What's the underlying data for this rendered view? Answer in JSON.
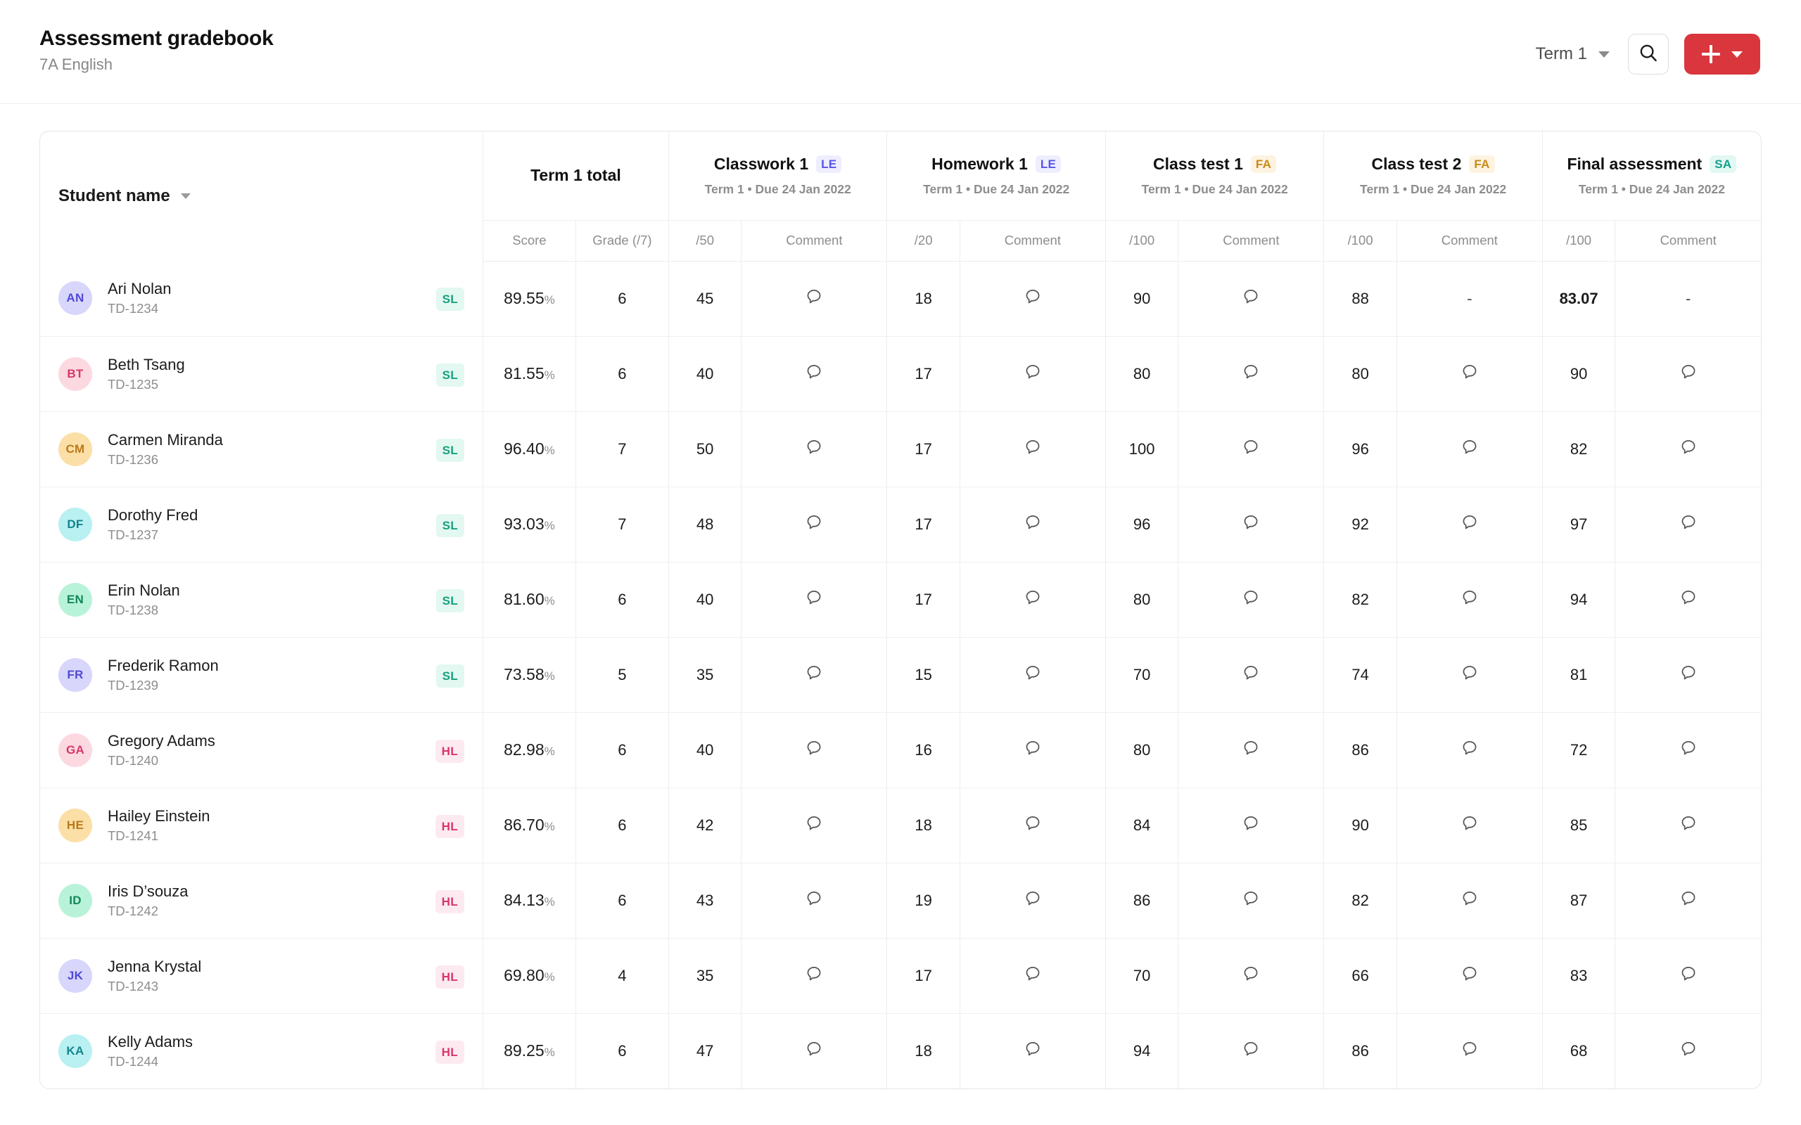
{
  "header": {
    "title": "Assessment gradebook",
    "subtitle": "7A English",
    "term_filter_label": "Term 1",
    "search_icon": "search-icon",
    "add_icon": "plus-icon",
    "add_caret_icon": "chevron-down-icon"
  },
  "table": {
    "name_column": {
      "label": "Student name",
      "sort_icon": "chevron-down-icon"
    },
    "groups": [
      {
        "title": "Term 1 total",
        "tag": "",
        "tag_class": "",
        "subtitle": "",
        "sub_headers": [
          "Score",
          "Grade (/7)"
        ]
      },
      {
        "title": "Classwork 1",
        "tag": "LE",
        "tag_class": "tag-le",
        "subtitle": "Term 1 • Due 24 Jan 2022",
        "sub_headers": [
          "/50",
          "Comment"
        ]
      },
      {
        "title": "Homework 1",
        "tag": "LE",
        "tag_class": "tag-le",
        "subtitle": "Term 1 • Due 24 Jan 2022",
        "sub_headers": [
          "/20",
          "Comment"
        ]
      },
      {
        "title": "Class test 1",
        "tag": "FA",
        "tag_class": "tag-fa",
        "subtitle": "Term 1 • Due 24 Jan 2022",
        "sub_headers": [
          "/100",
          "Comment"
        ]
      },
      {
        "title": "Class test 2",
        "tag": "FA",
        "tag_class": "tag-fa",
        "subtitle": "Term 1 • Due 24 Jan 2022",
        "sub_headers": [
          "/100",
          "Comment"
        ]
      },
      {
        "title": "Final assessment",
        "tag": "SA",
        "tag_class": "tag-sa",
        "subtitle": "Term 1 • Due 24 Jan 2022",
        "sub_headers": [
          "/100",
          "Comment"
        ]
      }
    ],
    "comment_icon": "comment-bubble-icon",
    "rows": [
      {
        "initials": "AN",
        "name": "Ari Nolan",
        "id": "TD-1234",
        "avatar_bg": "#d8d6fb",
        "avatar_fg": "#5049d6",
        "level": "SL",
        "level_class": "lvl-sl",
        "score": "89.55",
        "grade": "6",
        "classwork1": "45",
        "classwork1_comment": "bubble",
        "homework1": "18",
        "homework1_comment": "bubble",
        "classtest1": "90",
        "classtest1_comment": "bubble",
        "classtest2": "88",
        "classtest2_comment": "-",
        "final": "83.07",
        "final_bold": true,
        "final_comment": "-"
      },
      {
        "initials": "BT",
        "name": "Beth Tsang",
        "id": "TD-1235",
        "avatar_bg": "#fcd9e1",
        "avatar_fg": "#d8366a",
        "level": "SL",
        "level_class": "lvl-sl",
        "score": "81.55",
        "grade": "6",
        "classwork1": "40",
        "classwork1_comment": "bubble",
        "homework1": "17",
        "homework1_comment": "bubble",
        "classtest1": "80",
        "classtest1_comment": "bubble",
        "classtest2": "80",
        "classtest2_comment": "bubble",
        "final": "90",
        "final_bold": false,
        "final_comment": "bubble"
      },
      {
        "initials": "CM",
        "name": "Carmen Miranda",
        "id": "TD-1236",
        "avatar_bg": "#fbdfa6",
        "avatar_fg": "#b9791b",
        "level": "SL",
        "level_class": "lvl-sl",
        "score": "96.40",
        "grade": "7",
        "classwork1": "50",
        "classwork1_comment": "bubble",
        "homework1": "17",
        "homework1_comment": "bubble",
        "classtest1": "100",
        "classtest1_comment": "bubble",
        "classtest2": "96",
        "classtest2_comment": "bubble",
        "final": "82",
        "final_bold": false,
        "final_comment": "bubble"
      },
      {
        "initials": "DF",
        "name": "Dorothy Fred",
        "id": "TD-1237",
        "avatar_bg": "#b9f0f2",
        "avatar_fg": "#13868c",
        "level": "SL",
        "level_class": "lvl-sl",
        "score": "93.03",
        "grade": "7",
        "classwork1": "48",
        "classwork1_comment": "bubble",
        "homework1": "17",
        "homework1_comment": "bubble",
        "classtest1": "96",
        "classtest1_comment": "bubble",
        "classtest2": "92",
        "classtest2_comment": "bubble",
        "final": "97",
        "final_bold": false,
        "final_comment": "bubble"
      },
      {
        "initials": "EN",
        "name": "Erin Nolan",
        "id": "TD-1238",
        "avatar_bg": "#b8f3d9",
        "avatar_fg": "#13875c",
        "level": "SL",
        "level_class": "lvl-sl",
        "score": "81.60",
        "grade": "6",
        "classwork1": "40",
        "classwork1_comment": "bubble",
        "homework1": "17",
        "homework1_comment": "bubble",
        "classtest1": "80",
        "classtest1_comment": "bubble",
        "classtest2": "82",
        "classtest2_comment": "bubble",
        "final": "94",
        "final_bold": false,
        "final_comment": "bubble"
      },
      {
        "initials": "FR",
        "name": "Frederik Ramon",
        "id": "TD-1239",
        "avatar_bg": "#d8d6fb",
        "avatar_fg": "#5049d6",
        "level": "SL",
        "level_class": "lvl-sl",
        "score": "73.58",
        "grade": "5",
        "classwork1": "35",
        "classwork1_comment": "bubble",
        "homework1": "15",
        "homework1_comment": "bubble",
        "classtest1": "70",
        "classtest1_comment": "bubble",
        "classtest2": "74",
        "classtest2_comment": "bubble",
        "final": "81",
        "final_bold": false,
        "final_comment": "bubble"
      },
      {
        "initials": "GA",
        "name": "Gregory Adams",
        "id": "TD-1240",
        "avatar_bg": "#fcd9e1",
        "avatar_fg": "#d8366a",
        "level": "HL",
        "level_class": "lvl-hl",
        "score": "82.98",
        "grade": "6",
        "classwork1": "40",
        "classwork1_comment": "bubble",
        "homework1": "16",
        "homework1_comment": "bubble",
        "classtest1": "80",
        "classtest1_comment": "bubble",
        "classtest2": "86",
        "classtest2_comment": "bubble",
        "final": "72",
        "final_bold": false,
        "final_comment": "bubble"
      },
      {
        "initials": "HE",
        "name": "Hailey Einstein",
        "id": "TD-1241",
        "avatar_bg": "#fbdfa6",
        "avatar_fg": "#b9791b",
        "level": "HL",
        "level_class": "lvl-hl",
        "score": "86.70",
        "grade": "6",
        "classwork1": "42",
        "classwork1_comment": "bubble",
        "homework1": "18",
        "homework1_comment": "bubble",
        "classtest1": "84",
        "classtest1_comment": "bubble",
        "classtest2": "90",
        "classtest2_comment": "bubble",
        "final": "85",
        "final_bold": false,
        "final_comment": "bubble"
      },
      {
        "initials": "ID",
        "name": "Iris D’souza",
        "id": "TD-1242",
        "avatar_bg": "#b8f3d9",
        "avatar_fg": "#13875c",
        "level": "HL",
        "level_class": "lvl-hl",
        "score": "84.13",
        "grade": "6",
        "classwork1": "43",
        "classwork1_comment": "bubble",
        "homework1": "19",
        "homework1_comment": "bubble",
        "classtest1": "86",
        "classtest1_comment": "bubble",
        "classtest2": "82",
        "classtest2_comment": "bubble",
        "final": "87",
        "final_bold": false,
        "final_comment": "bubble"
      },
      {
        "initials": "JK",
        "name": "Jenna Krystal",
        "id": "TD-1243",
        "avatar_bg": "#d8d6fb",
        "avatar_fg": "#5049d6",
        "level": "HL",
        "level_class": "lvl-hl",
        "score": "69.80",
        "grade": "4",
        "classwork1": "35",
        "classwork1_comment": "bubble",
        "homework1": "17",
        "homework1_comment": "bubble",
        "classtest1": "70",
        "classtest1_comment": "bubble",
        "classtest2": "66",
        "classtest2_comment": "bubble",
        "final": "83",
        "final_bold": false,
        "final_comment": "bubble"
      },
      {
        "initials": "KA",
        "name": "Kelly Adams",
        "id": "TD-1244",
        "avatar_bg": "#b9f0f2",
        "avatar_fg": "#13868c",
        "level": "HL",
        "level_class": "lvl-hl",
        "score": "89.25",
        "grade": "6",
        "classwork1": "47",
        "classwork1_comment": "bubble",
        "homework1": "18",
        "homework1_comment": "bubble",
        "classtest1": "94",
        "classtest1_comment": "bubble",
        "classtest2": "86",
        "classtest2_comment": "bubble",
        "final": "68",
        "final_bold": false,
        "final_comment": "bubble"
      }
    ]
  }
}
